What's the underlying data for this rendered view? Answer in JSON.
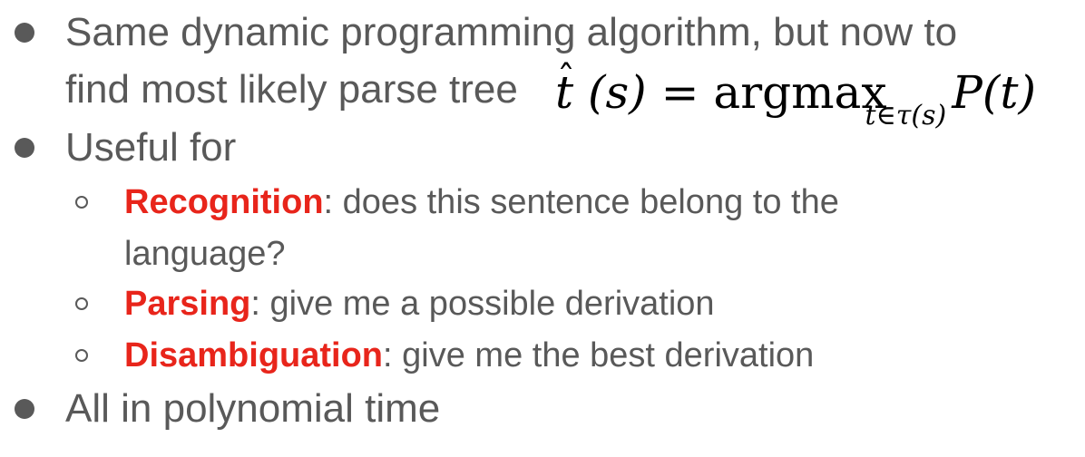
{
  "bullets": [
    {
      "line1": "Same dynamic programming algorithm, but now to",
      "line2": "find most likely parse tree"
    },
    {
      "text": "Useful for"
    },
    {
      "text": "All in polynomial time"
    }
  ],
  "subbullets": [
    {
      "term": "Recognition",
      "rest": ": does this sentence belong to the",
      "rest2": "language?"
    },
    {
      "term": "Parsing",
      "rest": ": give me a possible derivation"
    },
    {
      "term": "Disambiguation",
      "rest": ": give me the best derivation"
    }
  ],
  "formula": {
    "lhs_var": "t",
    "lhs_arg": "(s)",
    "equals": "=",
    "operator": "argmax",
    "subscript": "t∈τ(s)",
    "rhs": "P(t)"
  }
}
